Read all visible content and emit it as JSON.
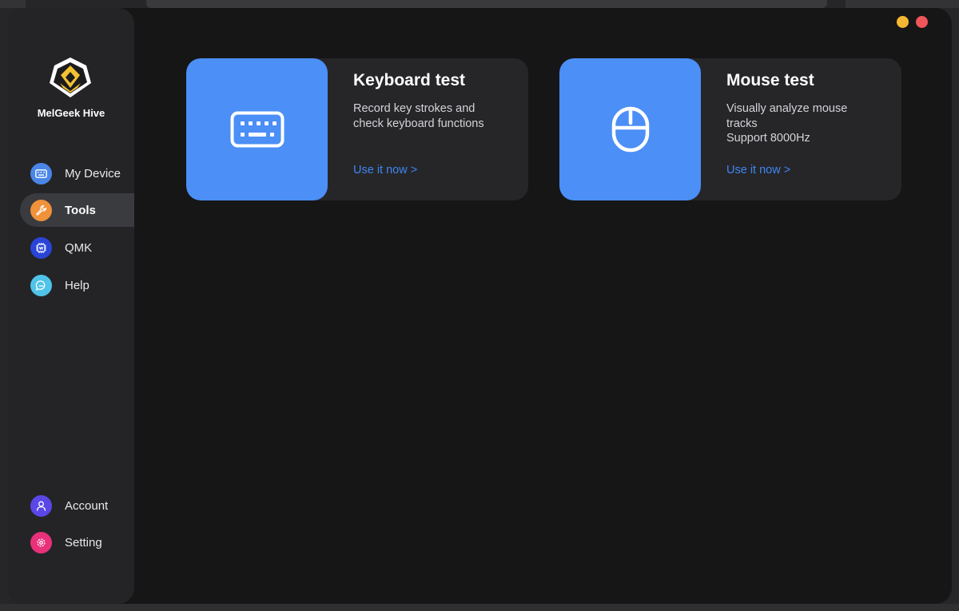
{
  "app": {
    "brand_name": "MelGeek Hive"
  },
  "sidebar": {
    "nav": [
      {
        "label": "My Device",
        "icon": "keyboard-icon",
        "color": "#4a86e8",
        "active": false
      },
      {
        "label": "Tools",
        "icon": "wrench-icon",
        "color": "#f0923a",
        "active": true
      },
      {
        "label": "QMK",
        "icon": "chip-icon",
        "color": "#2a45d6",
        "active": false
      },
      {
        "label": "Help",
        "icon": "chat-bubble-icon",
        "color": "#4fc3e8",
        "active": false
      }
    ],
    "bottom": [
      {
        "label": "Account",
        "icon": "user-icon",
        "color": "#5a47e6"
      },
      {
        "label": "Setting",
        "icon": "gear-icon",
        "color": "#e8317a"
      }
    ]
  },
  "window_controls": {
    "minimize_color": "#f5b731",
    "close_color": "#f0555a"
  },
  "cards": [
    {
      "title": "Keyboard test",
      "desc_lines": [
        "Record key strokes and",
        "check keyboard functions"
      ],
      "link": "Use it now >",
      "icon": "keyboard-icon"
    },
    {
      "title": "Mouse test",
      "desc_lines": [
        "Visually analyze mouse",
        "tracks",
        "Support 8000Hz"
      ],
      "link": "Use it now >",
      "icon": "mouse-icon"
    }
  ],
  "colors": {
    "accent": "#4b8ff7",
    "link": "#3f86f0"
  }
}
